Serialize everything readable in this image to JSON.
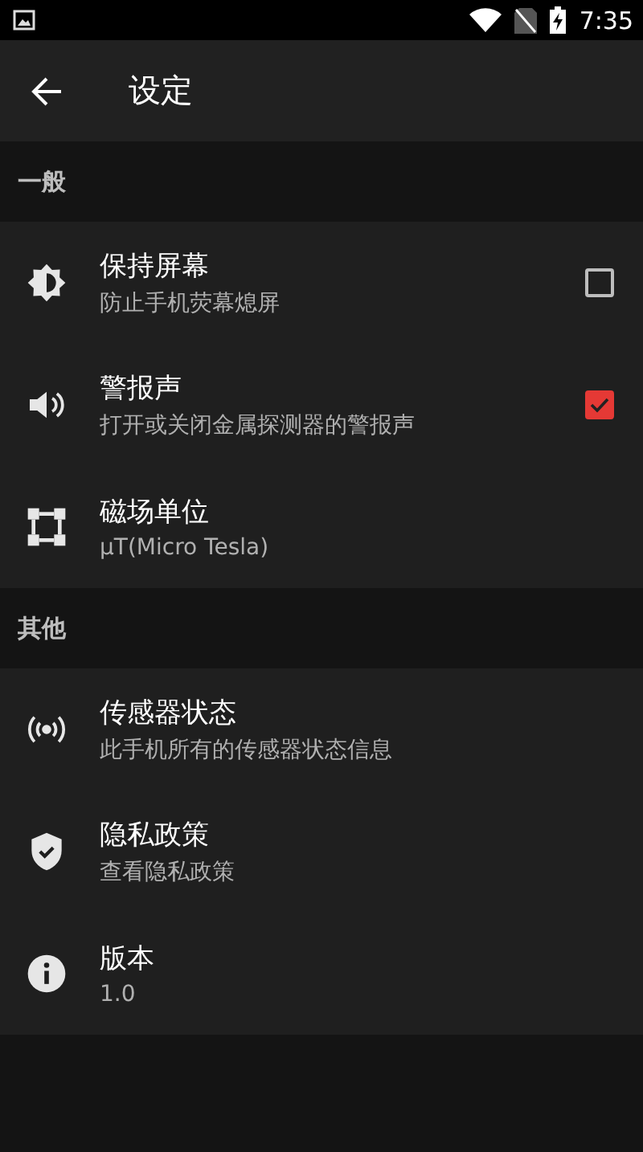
{
  "status_bar": {
    "time": "7:35"
  },
  "toolbar": {
    "title": "设定"
  },
  "sections": [
    {
      "header": "一般",
      "items": [
        {
          "kind": "checkbox",
          "title": "保持屏幕",
          "subtitle": "防止手机荧幕熄屏",
          "checked": false
        },
        {
          "kind": "checkbox",
          "title": "警报声",
          "subtitle": "打开或关闭金属探测器的警报声",
          "checked": true
        },
        {
          "kind": "plain",
          "title": "磁场单位",
          "subtitle": "μT(Micro Tesla)"
        }
      ]
    },
    {
      "header": "其他",
      "items": [
        {
          "kind": "plain",
          "title": "传感器状态",
          "subtitle": "此手机所有的传感器状态信息"
        },
        {
          "kind": "plain",
          "title": "隐私政策",
          "subtitle": "查看隐私政策"
        },
        {
          "kind": "plain",
          "title": "版本",
          "subtitle": "1.0"
        }
      ]
    }
  ]
}
